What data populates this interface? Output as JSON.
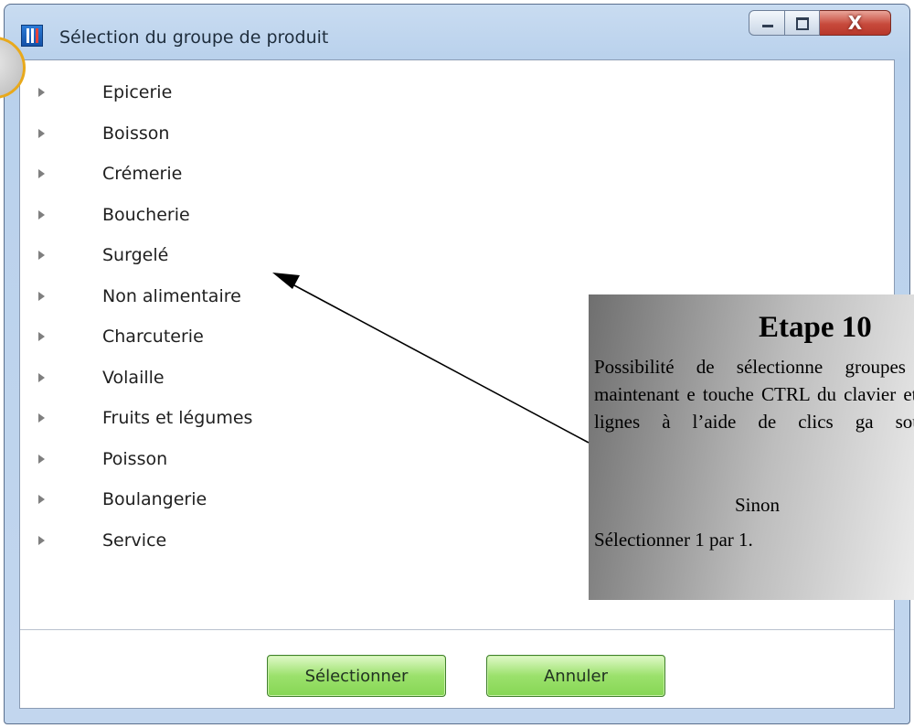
{
  "window": {
    "title": "Sélection du groupe de produit",
    "close_glyph": "X"
  },
  "list": {
    "items": [
      {
        "label": "Epicerie"
      },
      {
        "label": "Boisson"
      },
      {
        "label": "Crémerie"
      },
      {
        "label": "Boucherie"
      },
      {
        "label": "Surgelé"
      },
      {
        "label": "Non alimentaire"
      },
      {
        "label": "Charcuterie"
      },
      {
        "label": "Volaille"
      },
      {
        "label": "Fruits et légumes"
      },
      {
        "label": "Poisson"
      },
      {
        "label": "Boulangerie"
      },
      {
        "label": "Service"
      }
    ]
  },
  "footer": {
    "select_label": "Sélectionner",
    "cancel_label": "Annuler"
  },
  "callout": {
    "title": "Etape 10",
    "body": "Possibilité de sélectionne groupes en maintenant e touche CTRL du clavier et les lignes à l’aide de clics ga souris.",
    "sinon": "Sinon",
    "final": "Sélectionner 1 par 1."
  },
  "colors": {
    "button_green": "#9be16c",
    "close_red": "#c74a3c",
    "frame_blue": "#b9d1ec",
    "marker_gold": "#e8a91c"
  }
}
